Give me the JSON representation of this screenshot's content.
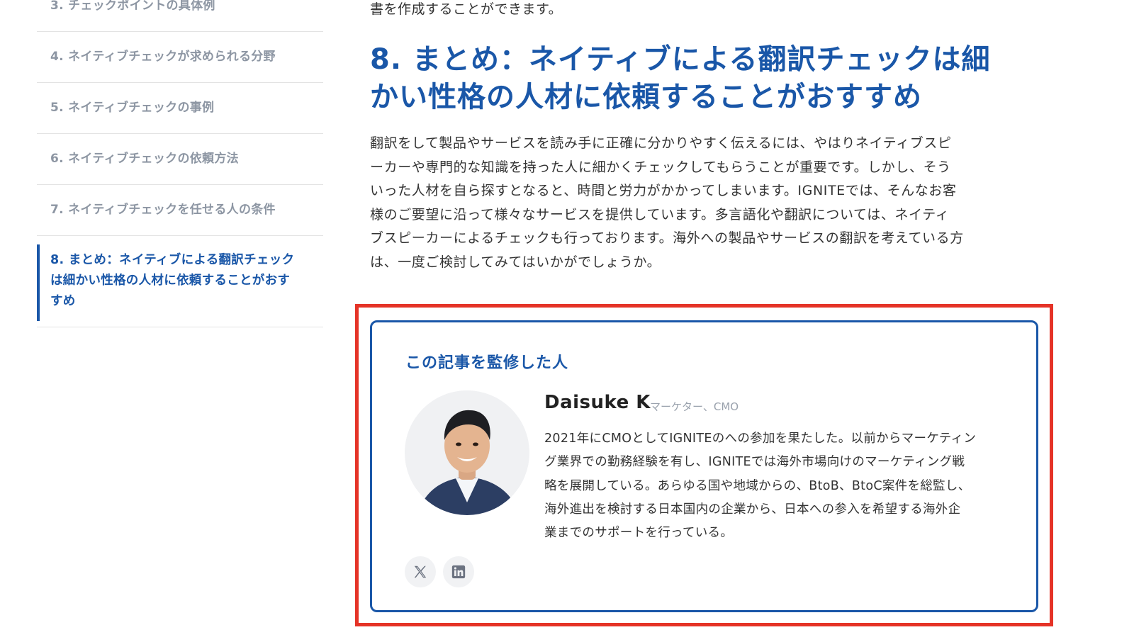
{
  "toc": {
    "items": [
      {
        "label": "3. チェックポイントの具体例"
      },
      {
        "label": "4. ネイティブチェックが求められる分野"
      },
      {
        "label": "5. ネイティブチェックの事例"
      },
      {
        "label": "6. ネイティブチェックの依頼方法"
      },
      {
        "label": "7. ネイティブチェックを任せる人の条件"
      },
      {
        "label_lines": [
          "8. まとめ：ネイティブによる翻訳チェック",
          "は細かい性格の人材に依頼することがおす",
          "すめ"
        ],
        "active": true
      }
    ]
  },
  "article": {
    "intro_tail": "書を作成することができます。",
    "heading_lines": [
      "8. まとめ：ネイティブによる翻訳チェックは細",
      "かい性格の人材に依頼することがおすすめ"
    ],
    "body_lines": [
      "翻訳をして製品やサービスを読み手に正確に分かりやすく伝えるには、やはりネイティブスピ",
      "ーカーや専門的な知識を持った人に細かくチェックしてもらうことが重要です。しかし、そう",
      "いった人材を自ら探すとなると、時間と労力がかかってしまいます。IGNITEでは、そんなお客",
      "様のご要望に沿って様々なサービスを提供しています。多言語化や翻訳については、ネイティ",
      "ブスピーカーによるチェックも行っております。海外への製品やサービスの翻訳を考えている方",
      "は、一度ご検討してみてはいかがでしょうか。"
    ]
  },
  "author_card": {
    "heading": "この記事を監修した人",
    "name": "Daisuke K",
    "role": "マーケター、CMO",
    "bio_lines": [
      "2021年にCMOとしてIGNITEのへの参加を果たした。以前からマーケティン",
      "グ業界での勤務経験を有し、IGNITEでは海外市場向けのマーケティング戦",
      "略を展開している。あらゆる国や地域からの、BtoB、BtoC案件を総監し、",
      "海外進出を検討する日本国内の企業から、日本への参入を希望する海外企",
      "業までのサポートを行っている。"
    ],
    "avatar_icon": "author-photo",
    "social": [
      {
        "icon": "x-icon"
      },
      {
        "icon": "linkedin-icon"
      }
    ]
  },
  "colors": {
    "brand_blue": "#1a57a8",
    "highlight_red": "#e53327",
    "toc_gray": "#8d96a3",
    "body_text": "#333333"
  }
}
